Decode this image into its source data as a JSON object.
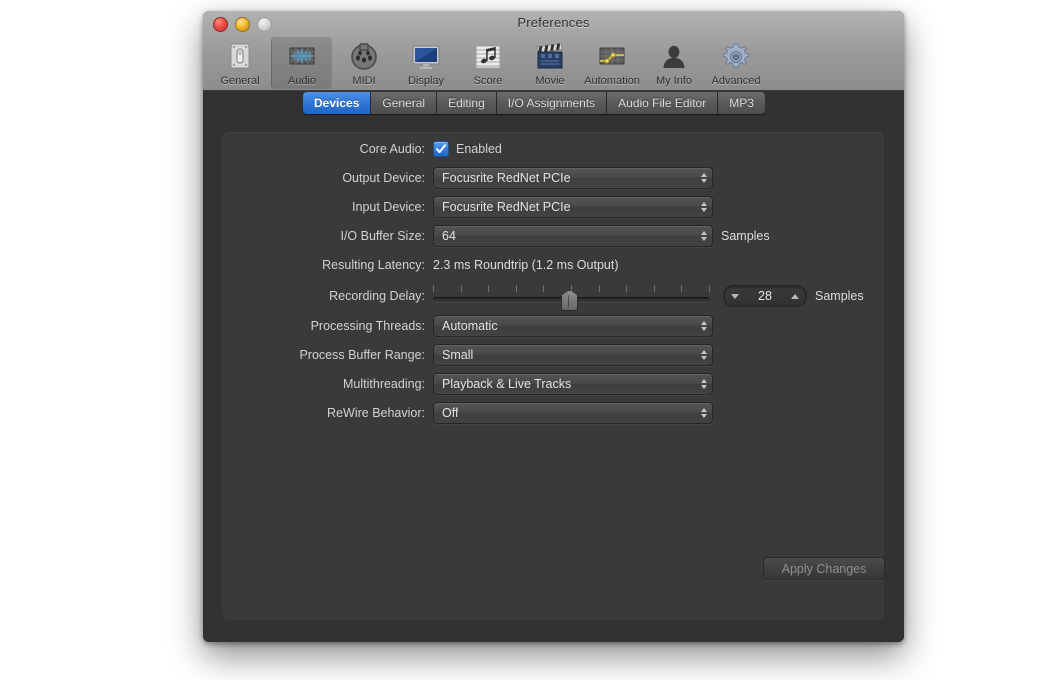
{
  "window": {
    "title": "Preferences",
    "traffic_lights": [
      "close-button",
      "minimize-button",
      "zoom-button"
    ]
  },
  "toolbar": {
    "items": [
      {
        "label": "General",
        "icon": "switch-icon",
        "selected": false
      },
      {
        "label": "Audio",
        "icon": "waveform-icon",
        "selected": true
      },
      {
        "label": "MIDI",
        "icon": "midi-port-icon",
        "selected": false
      },
      {
        "label": "Display",
        "icon": "monitor-icon",
        "selected": false
      },
      {
        "label": "Score",
        "icon": "music-note-icon",
        "selected": false
      },
      {
        "label": "Movie",
        "icon": "clapperboard-icon",
        "selected": false
      },
      {
        "label": "Automation",
        "icon": "automation-curve-icon",
        "selected": false
      },
      {
        "label": "My Info",
        "icon": "person-icon",
        "selected": false
      },
      {
        "label": "Advanced",
        "icon": "gear-icon",
        "selected": false
      }
    ]
  },
  "tabs": [
    {
      "label": "Devices",
      "active": true
    },
    {
      "label": "General",
      "active": false
    },
    {
      "label": "Editing",
      "active": false
    },
    {
      "label": "I/O Assignments",
      "active": false
    },
    {
      "label": "Audio File Editor",
      "active": false
    },
    {
      "label": "MP3",
      "active": false
    }
  ],
  "form": {
    "core_audio": {
      "label": "Core Audio:",
      "checkbox_label": "Enabled",
      "checked": true
    },
    "output_device": {
      "label": "Output Device:",
      "value": "Focusrite RedNet PCIe"
    },
    "input_device": {
      "label": "Input Device:",
      "value": "Focusrite RedNet PCIe"
    },
    "io_buffer_size": {
      "label": "I/O Buffer Size:",
      "value": "64",
      "unit": "Samples"
    },
    "resulting_latency": {
      "label": "Resulting Latency:",
      "value": "2.3 ms Roundtrip (1.2 ms Output)"
    },
    "recording_delay": {
      "label": "Recording Delay:",
      "value": "28",
      "unit": "Samples",
      "slider_percent": 49,
      "tick_count": 11
    },
    "processing_threads": {
      "label": "Processing Threads:",
      "value": "Automatic"
    },
    "process_buffer_range": {
      "label": "Process Buffer Range:",
      "value": "Small"
    },
    "multithreading": {
      "label": "Multithreading:",
      "value": "Playback & Live Tracks"
    },
    "rewire_behavior": {
      "label": "ReWire Behavior:",
      "value": "Off"
    }
  },
  "actions": {
    "apply_label": "Apply Changes",
    "apply_enabled": false
  },
  "colors": {
    "accent_blue": "#2f76d6",
    "window_bg": "#323232",
    "panel_bg": "#3a3a3a",
    "text": "#d2d2d2"
  }
}
